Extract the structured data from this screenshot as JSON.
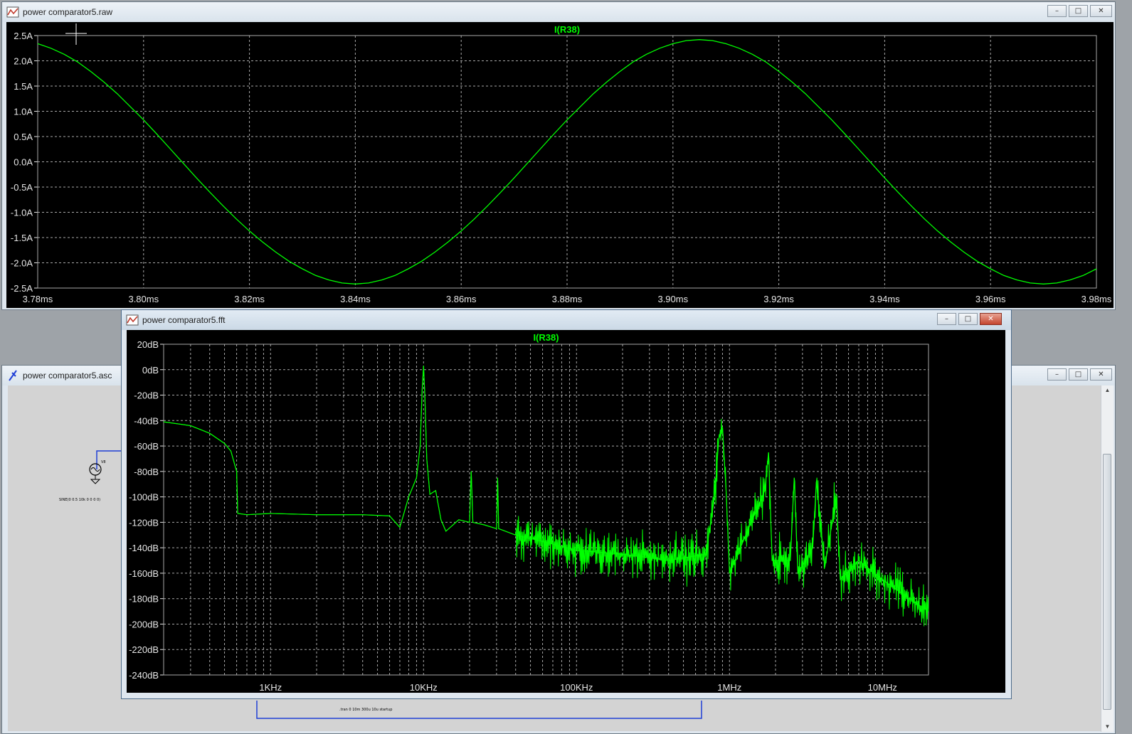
{
  "colors": {
    "trace": "#00ff00",
    "grid": "#a8a8a8",
    "axis_text": "#e6e6e6",
    "plot_bg": "#000000",
    "wire": "#1f3fd6"
  },
  "windows": {
    "raw": {
      "title": "power comparator5.raw",
      "icon": "waveform-icon"
    },
    "fft": {
      "title": "power comparator5.fft",
      "icon": "waveform-icon"
    },
    "asc": {
      "title": "power comparator5.asc",
      "icon": "schematic-icon",
      "source_label": "V8",
      "source_value": "SINE(0 0.5 10k 0 0 0 0)",
      "directive": ".tran 0 10m 300u 10u startup"
    }
  },
  "controls": {
    "minimize": "–",
    "maximize": "□",
    "close": "✕"
  },
  "chart_data": [
    {
      "type": "line",
      "title": "I(R38)",
      "xlabel": "",
      "ylabel": "",
      "x_ticks": [
        "3.78ms",
        "3.80ms",
        "3.82ms",
        "3.84ms",
        "3.86ms",
        "3.88ms",
        "3.90ms",
        "3.92ms",
        "3.94ms",
        "3.96ms",
        "3.98ms"
      ],
      "y_ticks": [
        "2.5A",
        "2.0A",
        "1.5A",
        "1.0A",
        "0.5A",
        "0.0A",
        "-0.5A",
        "-1.0A",
        "-1.5A",
        "-2.0A",
        "-2.5A"
      ],
      "xlim": [
        3.78,
        3.98
      ],
      "ylim": [
        -2.5,
        2.5
      ],
      "grid": true,
      "series": [
        {
          "name": "I(R38)",
          "x": [
            3.78,
            3.7825,
            3.785,
            3.7875,
            3.79,
            3.7925,
            3.795,
            3.7975,
            3.8,
            3.8025,
            3.805,
            3.8075,
            3.81,
            3.8125,
            3.815,
            3.8175,
            3.82,
            3.8225,
            3.825,
            3.8275,
            3.83,
            3.8325,
            3.835,
            3.8375,
            3.84,
            3.8425,
            3.845,
            3.8475,
            3.85,
            3.8525,
            3.855,
            3.8575,
            3.86,
            3.8625,
            3.865,
            3.8675,
            3.87,
            3.8725,
            3.875,
            3.8775,
            3.88,
            3.8825,
            3.885,
            3.8875,
            3.89,
            3.8925,
            3.895,
            3.8975,
            3.9,
            3.9025,
            3.905,
            3.9075,
            3.91,
            3.9125,
            3.915,
            3.9175,
            3.92,
            3.9225,
            3.925,
            3.9275,
            3.93,
            3.9325,
            3.935,
            3.9375,
            3.94,
            3.9425,
            3.945,
            3.9475,
            3.95,
            3.9525,
            3.955,
            3.9575,
            3.96,
            3.9625,
            3.965,
            3.9675,
            3.97,
            3.9725,
            3.975,
            3.9775,
            3.98
          ],
          "y": [
            2.34,
            2.25,
            2.13,
            1.98,
            1.79,
            1.58,
            1.35,
            1.09,
            0.83,
            0.55,
            0.26,
            -0.03,
            -0.32,
            -0.6,
            -0.87,
            -1.13,
            -1.37,
            -1.59,
            -1.79,
            -1.97,
            -2.12,
            -2.25,
            -2.34,
            -2.4,
            -2.42,
            -2.4,
            -2.34,
            -2.25,
            -2.12,
            -1.97,
            -1.79,
            -1.59,
            -1.37,
            -1.13,
            -0.87,
            -0.6,
            -0.32,
            -0.03,
            0.26,
            0.55,
            0.83,
            1.09,
            1.35,
            1.58,
            1.79,
            1.98,
            2.13,
            2.25,
            2.34,
            2.4,
            2.42,
            2.4,
            2.34,
            2.25,
            2.13,
            1.98,
            1.79,
            1.58,
            1.35,
            1.09,
            0.83,
            0.55,
            0.26,
            -0.03,
            -0.32,
            -0.6,
            -0.87,
            -1.13,
            -1.37,
            -1.59,
            -1.79,
            -1.97,
            -2.12,
            -2.25,
            -2.34,
            -2.4,
            -2.42,
            -2.4,
            -2.34,
            -2.25,
            -2.12
          ]
        }
      ]
    },
    {
      "type": "line",
      "title": "I(R38)",
      "xlabel": "",
      "ylabel": "",
      "x_scale": "log",
      "x_ticks": [
        "1KHz",
        "10KHz",
        "100KHz",
        "1MHz",
        "10MHz"
      ],
      "y_ticks": [
        "20dB",
        "0dB",
        "-20dB",
        "-40dB",
        "-60dB",
        "-80dB",
        "-100dB",
        "-120dB",
        "-140dB",
        "-160dB",
        "-180dB",
        "-200dB",
        "-220dB",
        "-240dB"
      ],
      "xlim": [
        200,
        20000000
      ],
      "ylim": [
        -240,
        20
      ],
      "grid": true,
      "series": [
        {
          "name": "I(R38)",
          "x": [
            200,
            300,
            400,
            500,
            550,
            600,
            610,
            700,
            1000,
            2000,
            4000,
            6000,
            7000,
            8000,
            9000,
            9500,
            9800,
            10000,
            10200,
            10500,
            11000,
            12000,
            13000,
            14000,
            17000,
            20000,
            20500,
            21000,
            25000,
            30000,
            30500,
            31000,
            40000,
            60000,
            100000,
            200000,
            400000,
            700000,
            800000,
            850000,
            900000,
            950000,
            1000000,
            1700000,
            1800000,
            1900000,
            2500000,
            2650000,
            2800000,
            3500000,
            3700000,
            4200000,
            4400000,
            5000000,
            5300000,
            7000000,
            10000000,
            15000000,
            20000000
          ],
          "y": [
            -41,
            -44,
            -50,
            -58,
            -64,
            -80,
            -113,
            -114,
            -113,
            -114,
            -114,
            -115,
            -124,
            -100,
            -85,
            -60,
            -15,
            3,
            -20,
            -70,
            -98,
            -95,
            -118,
            -127,
            -118,
            -120,
            -80,
            -120,
            -122,
            -125,
            -85,
            -125,
            -130,
            -135,
            -142,
            -145,
            -150,
            -145,
            -100,
            -55,
            -45,
            -95,
            -160,
            -95,
            -65,
            -150,
            -150,
            -85,
            -160,
            -140,
            -88,
            -155,
            -140,
            -100,
            -165,
            -150,
            -165,
            -180,
            -190
          ]
        }
      ]
    }
  ]
}
